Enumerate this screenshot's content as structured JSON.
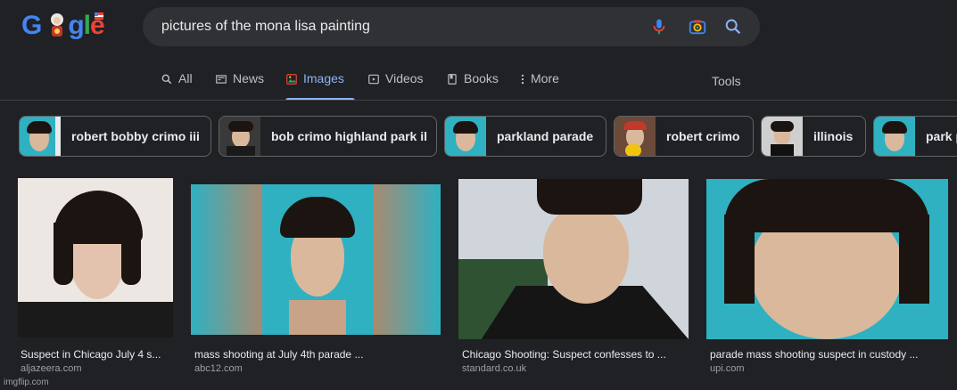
{
  "logo": {
    "letters": [
      "G",
      "o",
      "o",
      "g",
      "l",
      "e"
    ],
    "colors": [
      "#4285f4",
      "#ea4335",
      "#fbbc05",
      "#4285f4",
      "#34a853",
      "#ea4335"
    ]
  },
  "search": {
    "query": "pictures of the mona lisa painting"
  },
  "tabs": [
    {
      "label": "All",
      "icon": "search-icon"
    },
    {
      "label": "News",
      "icon": "news-icon"
    },
    {
      "label": "Images",
      "icon": "images-icon",
      "active": true
    },
    {
      "label": "Videos",
      "icon": "video-icon"
    },
    {
      "label": "Books",
      "icon": "book-icon"
    },
    {
      "label": "More",
      "icon": "more-vert-icon"
    }
  ],
  "tools_label": "Tools",
  "chips": [
    {
      "label": "robert bobby crimo iii"
    },
    {
      "label": "bob crimo highland park il"
    },
    {
      "label": "parkland parade"
    },
    {
      "label": "robert crimo"
    },
    {
      "label": "illinois"
    },
    {
      "label": "park p"
    }
  ],
  "results": [
    {
      "caption": "Suspect in Chicago July 4 s...",
      "source": "aljazeera.com"
    },
    {
      "caption": "mass shooting at July 4th parade ...",
      "source": "abc12.com"
    },
    {
      "caption": "Chicago Shooting: Suspect confesses to ...",
      "source": "standard.co.uk"
    },
    {
      "caption": "parade mass shooting suspect in custody ...",
      "source": "upi.com"
    }
  ],
  "watermark": "imgflip.com",
  "colors": {
    "background": "#202124",
    "accent": "#8ab4f8",
    "teal_bg": "#2fb1c2"
  }
}
